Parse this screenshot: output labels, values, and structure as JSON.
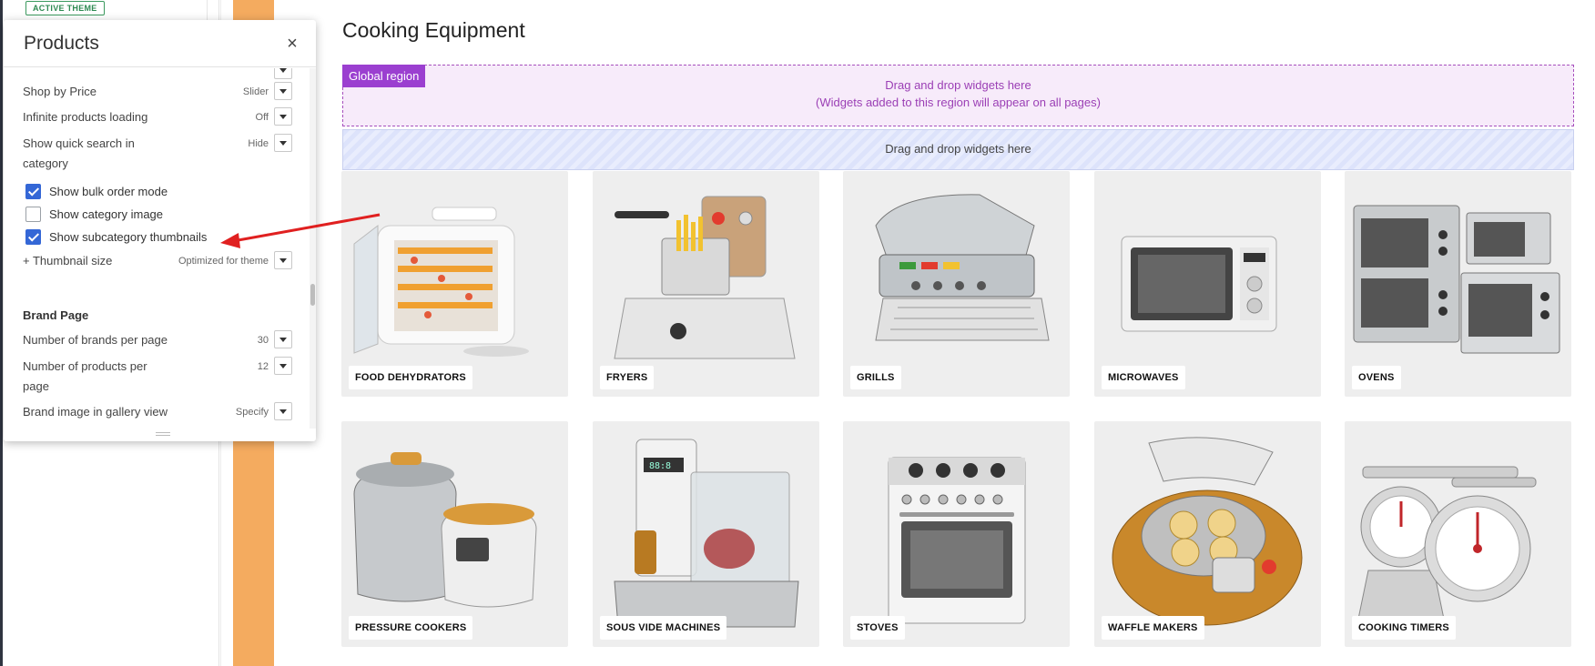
{
  "sidebar": {
    "badge": "ACTIVE THEME"
  },
  "panel": {
    "title": "Products",
    "close": "×",
    "settings": [
      {
        "label": "Shop by Price",
        "value": "Slider"
      },
      {
        "label": "Infinite products loading",
        "value": "Off"
      },
      {
        "label": "Show quick search in category",
        "value": "Hide"
      }
    ],
    "checkboxes": [
      {
        "label": "Show bulk order mode",
        "checked": true
      },
      {
        "label": "Show category image",
        "checked": false
      },
      {
        "label": "Show subcategory thumbnails",
        "checked": true
      }
    ],
    "thumbnail_size": {
      "label": "+ Thumbnail size",
      "value": "Optimized for theme"
    },
    "brand_section": "Brand Page",
    "brand_settings": [
      {
        "label": "Number of brands per page",
        "value": "30"
      },
      {
        "label": "Number of products per page",
        "value": "12"
      },
      {
        "label": "Brand image in gallery view",
        "value": "Specify"
      }
    ]
  },
  "main": {
    "title": "Cooking Equipment",
    "global_tag": "Global region",
    "global_line1": "Drag and drop widgets here",
    "global_line2": "(Widgets added to this region will appear on all pages)",
    "drop_text": "Drag and drop widgets here",
    "categories": [
      {
        "label": "FOOD DEHYDRATORS",
        "icon": "food-dehydrator-image"
      },
      {
        "label": "FRYERS",
        "icon": "fryer-image"
      },
      {
        "label": "GRILLS",
        "icon": "grill-image"
      },
      {
        "label": "MICROWAVES",
        "icon": "microwave-image"
      },
      {
        "label": "OVENS",
        "icon": "oven-image"
      },
      {
        "label": "PRESSURE COOKERS",
        "icon": "pressure-cooker-image"
      },
      {
        "label": "SOUS VIDE MACHINES",
        "icon": "sous-vide-image"
      },
      {
        "label": "STOVES",
        "icon": "stove-image"
      },
      {
        "label": "WAFFLE MAKERS",
        "icon": "waffle-maker-image"
      },
      {
        "label": "COOKING TIMERS",
        "icon": "cooking-timer-image"
      }
    ]
  },
  "colors": {
    "accent": "#3467d6",
    "region": "#9b3fd0",
    "orange": "#f4ab5f",
    "arrow": "#e02020"
  }
}
